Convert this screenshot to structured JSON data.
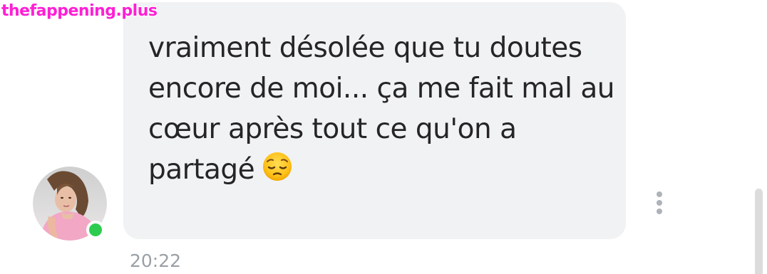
{
  "watermark": {
    "text": "thefappening.plus"
  },
  "message": {
    "text": "vraiment désolée que tu doutes encore de moi... ça me fait mal au cœur après tout ce qu'on a partagé",
    "emoji": "pensive-face-icon",
    "time": "20:22",
    "bubble_color": "#f1f2f4",
    "text_color": "#252527"
  },
  "sender": {
    "status": "online",
    "status_color": "#2ecc4e"
  },
  "colors": {
    "timestamp": "#9aa0a6",
    "more_dots": "#aeb3b9",
    "watermark": "#ff1fd4"
  }
}
